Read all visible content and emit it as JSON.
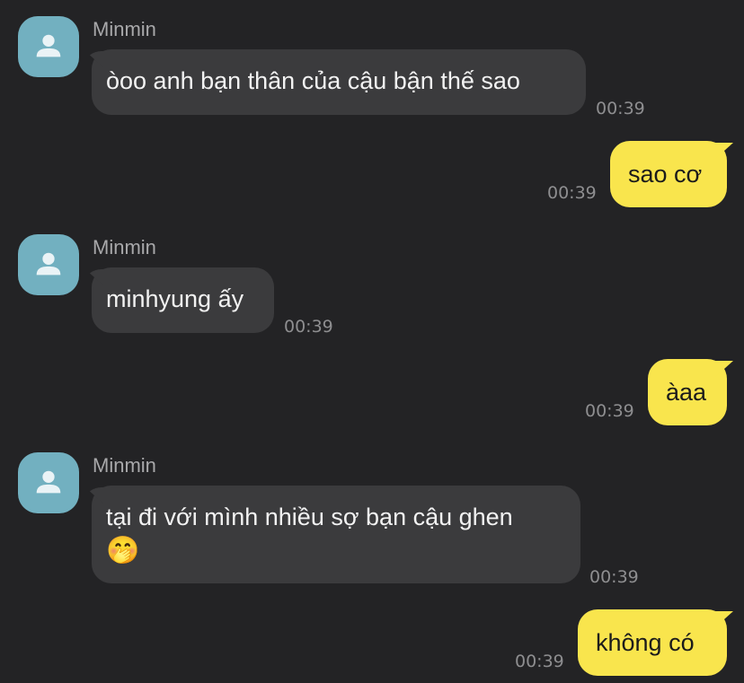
{
  "messages": [
    {
      "direction": "in",
      "sender": "Minmin",
      "text": "òoo anh bạn thân của cậu bận thế sao",
      "time": "00:39"
    },
    {
      "direction": "out",
      "text": "sao cơ",
      "time": "00:39"
    },
    {
      "direction": "in",
      "sender": "Minmin",
      "text": "minhyung ấy",
      "time": "00:39"
    },
    {
      "direction": "out",
      "text": "àaa",
      "time": "00:39"
    },
    {
      "direction": "in",
      "sender": "Minmin",
      "text": "tại đi với mình nhiều sợ bạn cậu ghen",
      "emoji": "🤭",
      "time": "00:39"
    },
    {
      "direction": "out",
      "text": "không có",
      "time": "00:39"
    }
  ],
  "icons": {
    "avatar": "default-user-silhouette-icon"
  },
  "colors": {
    "background": "#232325",
    "incoming_bubble": "#3b3b3d",
    "outgoing_bubble": "#f9e54d",
    "avatar": "#72b0c0"
  }
}
